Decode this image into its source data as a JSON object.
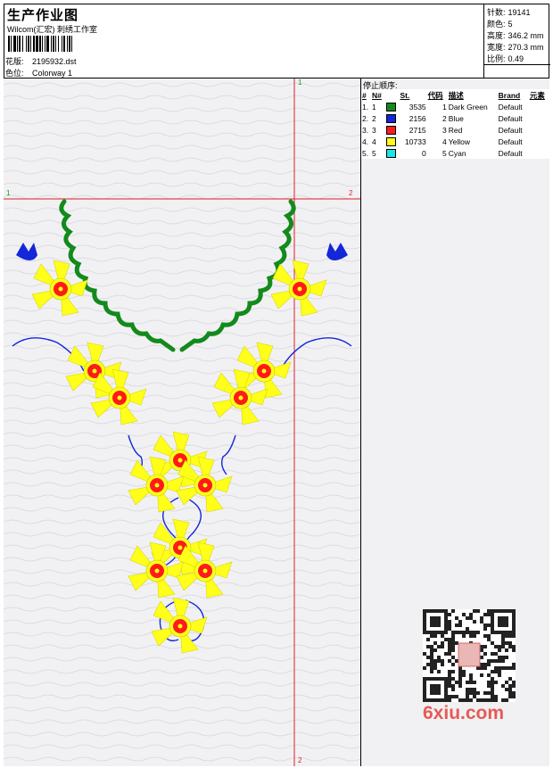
{
  "header": {
    "title": "生产作业图",
    "studio": "Wilcom(汇宏) 刺绣工作室",
    "design_label": "花版:",
    "design_value": "2195932.dst",
    "colorway_label": "色位:",
    "colorway_value": "Colorway 1"
  },
  "stats": {
    "stitches_label": "针数:",
    "stitches_value": "19141",
    "colors_label": "颜色:",
    "colors_value": "5",
    "height_label": "高度:",
    "height_value": "346.2 mm",
    "width_label": "宽度:",
    "width_value": "270.3 mm",
    "scale_label": "比例:",
    "scale_value": "0.49"
  },
  "stops": {
    "title": "停止顺序:",
    "columns": [
      "#",
      "N#",
      "St.",
      "代码",
      "描述",
      "Brand",
      "元素"
    ],
    "rows": [
      {
        "idx": "1.",
        "n": "1",
        "color": "#138a1c",
        "st": "3535",
        "code": "1",
        "desc": "Dark Green",
        "brand": "Default"
      },
      {
        "idx": "2.",
        "n": "2",
        "color": "#1326d8",
        "st": "2156",
        "code": "2",
        "desc": "Blue",
        "brand": "Default"
      },
      {
        "idx": "3.",
        "n": "3",
        "color": "#ff1a1a",
        "st": "2715",
        "code": "3",
        "desc": "Red",
        "brand": "Default"
      },
      {
        "idx": "4.",
        "n": "4",
        "color": "#ffff1a",
        "st": "10733",
        "code": "4",
        "desc": "Yellow",
        "brand": "Default"
      },
      {
        "idx": "5.",
        "n": "5",
        "color": "#1ae6e6",
        "st": "0",
        "code": "5",
        "desc": "Cyan",
        "brand": "Default"
      }
    ]
  },
  "guides": {
    "v_top": "1",
    "v_bottom": "2",
    "h_left": "1",
    "h_right": "2"
  },
  "watermark": "6xiu.com",
  "colors": {
    "guide": "#e0202a",
    "green": "#138a1c",
    "blue": "#1326d8",
    "red": "#ff1a1a",
    "yellow": "#ffff1a"
  }
}
